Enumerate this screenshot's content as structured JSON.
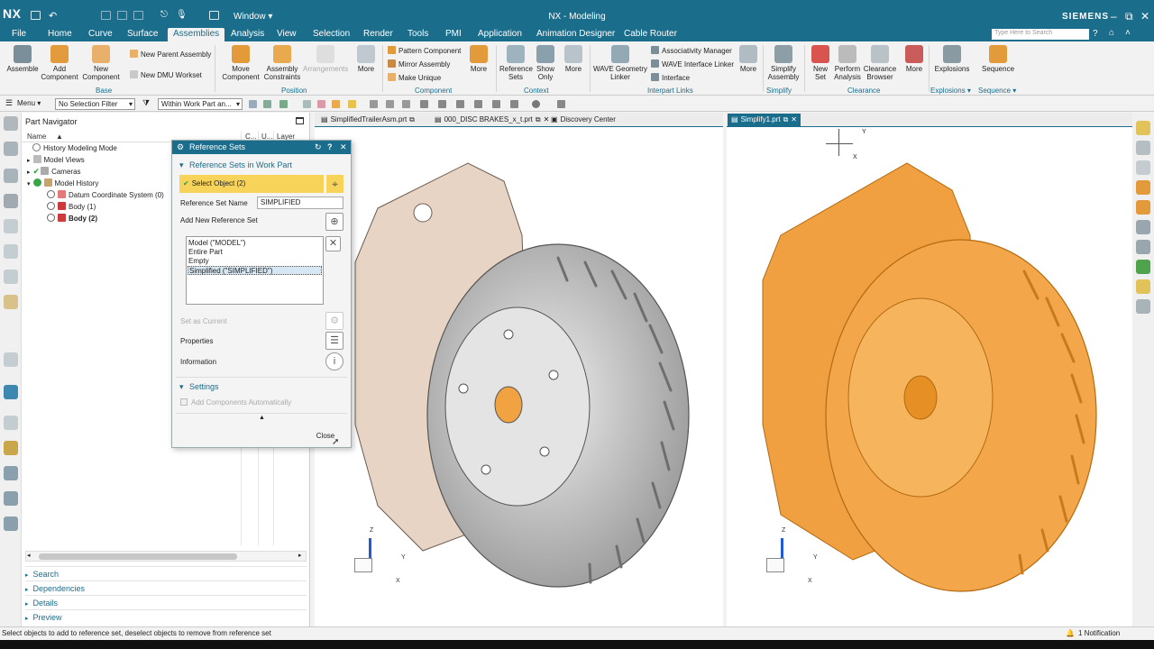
{
  "title_bar": {
    "logo": "NX",
    "window_menu": "Window ▾",
    "title": "NX - Modeling",
    "brand": "SIEMENS"
  },
  "menu": {
    "items": [
      "File",
      "Home",
      "Curve",
      "Surface",
      "Assemblies",
      "Analysis",
      "View",
      "Selection",
      "Render",
      "Tools",
      "PMI",
      "Application",
      "Animation Designer",
      "Cable Router"
    ],
    "active": "Assemblies",
    "search_placeholder": "Type Here to Search"
  },
  "ribbon": {
    "assemble": "Assemble",
    "add_component": "Add Component",
    "new_component": "New Component",
    "new_parent_assembly": "New Parent Assembly",
    "new_dmu_workset": "New DMU Workset",
    "move_component": "Move Component",
    "assembly_constraints": "Assembly Constraints",
    "arrangements": "Arrangements",
    "more1": "More",
    "pattern_component": "Pattern Component",
    "mirror_assembly": "Mirror Assembly",
    "make_unique": "Make Unique",
    "more2": "More",
    "reference_sets": "Reference Sets",
    "show_only": "Show Only",
    "more3": "More",
    "wave_geometry_linker": "WAVE Geometry Linker",
    "associativity_manager": "Associativity Manager",
    "wave_interface_linker": "WAVE Interface Linker",
    "interface": "Interface",
    "more4": "More",
    "simplify_assembly": "Simplify Assembly",
    "new_set": "New Set",
    "perform_analysis": "Perform Analysis",
    "clearance_browser": "Clearance Browser",
    "more5": "More",
    "explosions": "Explosions",
    "sequence": "Sequence",
    "groups": {
      "base": "Base",
      "position": "Position",
      "component": "Component",
      "context": "Context",
      "interpart_links": "Interpart Links",
      "simplify": "Simplify",
      "clearance": "Clearance",
      "explosions": "Explosions ▾",
      "sequence": "Sequence ▾"
    }
  },
  "toolbar": {
    "menu": "Menu ▾",
    "selection_filter": "No Selection Filter",
    "scope": "Within Work Part an..."
  },
  "navigator": {
    "title": "Part Navigator",
    "columns": {
      "name": "Name",
      "c": "C...",
      "u": "U...",
      "layer": "Layer"
    },
    "tree": {
      "history_mode": "History Modeling Mode",
      "model_views": "Model Views",
      "cameras": "Cameras",
      "model_history": "Model History",
      "datum": "Datum Coordinate System (0)",
      "body1": "Body (1)",
      "body2": "Body (2)"
    },
    "sections": [
      "Search",
      "Dependencies",
      "Details",
      "Preview"
    ]
  },
  "dialog": {
    "title": "Reference Sets",
    "section_work_part": "Reference Sets in Work Part",
    "select_object": "Select Object (2)",
    "ref_set_name_label": "Reference Set Name",
    "ref_set_name_value": "SIMPLIFIED",
    "add_new_label": "Add New Reference Set",
    "list": [
      "Model (\"MODEL\")",
      "Entire Part",
      "Empty",
      "Simplified (\"SIMPLIFIED\")"
    ],
    "set_as_current": "Set as Current",
    "properties": "Properties",
    "information": "Information",
    "settings": "Settings",
    "add_components_auto": "Add Components Automatically",
    "close": "Close"
  },
  "tabs": {
    "left": [
      "SimplifiedTrailerAsm.prt",
      "000_DISC BRAKES_x_t.prt",
      "Discovery Center"
    ],
    "right": "Simplify1.prt"
  },
  "axes": {
    "x": "X",
    "y": "Y",
    "z": "Z"
  },
  "status": {
    "message": "Select objects to add to reference set, deselect objects to remove from reference set",
    "notification": "1 Notification"
  },
  "colors": {
    "accent": "#1b6d8c",
    "highlight": "#f7d35a",
    "orange_part": "#f0a040"
  }
}
